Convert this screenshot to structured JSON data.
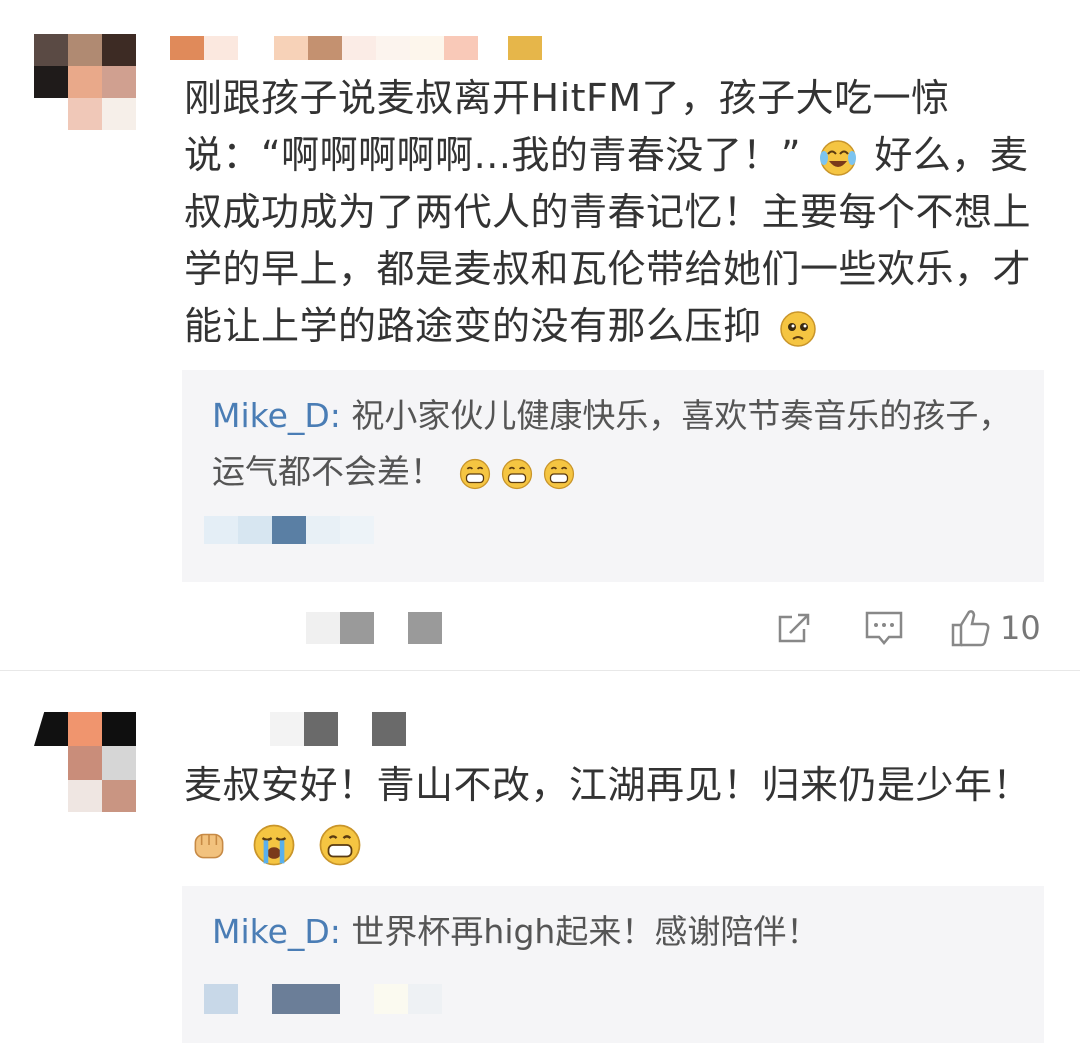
{
  "comments": [
    {
      "text": "刚跟孩子说麦叔离开HitFM了，孩子大吃一惊说：“啊啊啊啊啊...我的青春没了！”",
      "text_after": "好么，麦叔成功成为了两代人的青春记忆！主要每个不想上学的早上，都是麦叔和瓦伦带给她们一些欢乐，才能让上学的路途变的没有那么压抑",
      "reply": {
        "user": "Mike_D:",
        "text": "祝小家伙儿健康快乐，喜欢节奏音乐的孩子，运气都不会差！"
      },
      "like_count": "10"
    },
    {
      "text": "麦叔安好！青山不改，江湖再见！归来仍是少年！",
      "reply": {
        "user": "Mike_D:",
        "text": "世界杯再high起来！感谢陪伴！"
      }
    }
  ],
  "icons": {
    "share": "share-icon",
    "comment": "comment-icon",
    "like": "thumbs-up-icon",
    "laugh_cry": "laughing-crying-emoji",
    "sad": "pleading-emoji",
    "grin": "grinning-emoji",
    "fist": "fist-emoji",
    "crying": "crying-emoji"
  },
  "colors": {
    "reply_user": "#4a7db5",
    "reply_bg": "#f5f5f7",
    "text": "#333333"
  }
}
